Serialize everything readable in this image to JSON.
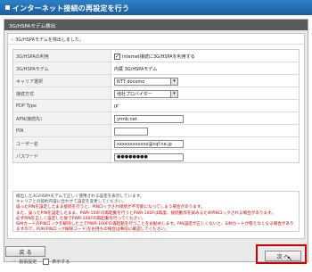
{
  "window": {
    "title": "インターネット接続の再設定を行う"
  },
  "panel": {
    "title": "3G/HSPAモデム検出"
  },
  "notice": "3G/HSPAモデムを検出しました。",
  "form": {
    "rows": [
      {
        "label": "3G/HSPAの利用",
        "type": "checkbox",
        "checked": true,
        "value": "Internet接続に3G/HSPAを利用する"
      },
      {
        "label": "3G/HSPAモデム",
        "type": "text",
        "value": "内蔵 3G/HSPAモデム"
      },
      {
        "label": "キャリア選択",
        "type": "select",
        "value": "NTT docomo"
      },
      {
        "label": "接続方式",
        "type": "select",
        "value": "他社プロバイダー"
      },
      {
        "label": "PDP Type",
        "type": "text",
        "value": "IP"
      },
      {
        "label": "APN(接続先)",
        "type": "input",
        "value": "yrmb.net"
      },
      {
        "label": "PIN",
        "type": "input",
        "value": ""
      },
      {
        "label": "ユーザー名",
        "type": "input",
        "value": "xxxxxxxxxxxx@cqf.ne.jp"
      },
      {
        "label": "パスワード",
        "type": "input",
        "value": "●●●●●●●●"
      }
    ]
  },
  "info": {
    "lines_normal": [
      "検出した3G/HSPAモデムで正しく使用される設定を表示しています。",
      "キャリアとの契約内容に合わせて設定を変更してください。"
    ],
    "lines_red": [
      "誤ったPINを設定したまま接続を行うと、PINロックされ接続が不可能になってしまう場合があります。",
      "また、誤ったPINを設定したまま、PWR-100Fの再起動を行うとPWR-100Fは再度、接続動作を試みるためPINロックされる場合があります。",
      "必ずPINを正しく設定した後でPWR-100Fの再起動を行ってください。",
      "SIMカードのPINロックを解除した上でPWR-100Fの再起動を行うことをお勧めします。PIN設定が正しくないと、SIMカードが使えなくなる場合がありますので、PUK(PINロック解除コード)をお持ちの場合は事前に確認してください。"
    ]
  },
  "extended": {
    "label": "拡張設定",
    "checkbox_label": "表示する",
    "checked": false
  },
  "buttons": {
    "back": "戻 る",
    "next": "次 へ"
  },
  "cursor": "↖"
}
